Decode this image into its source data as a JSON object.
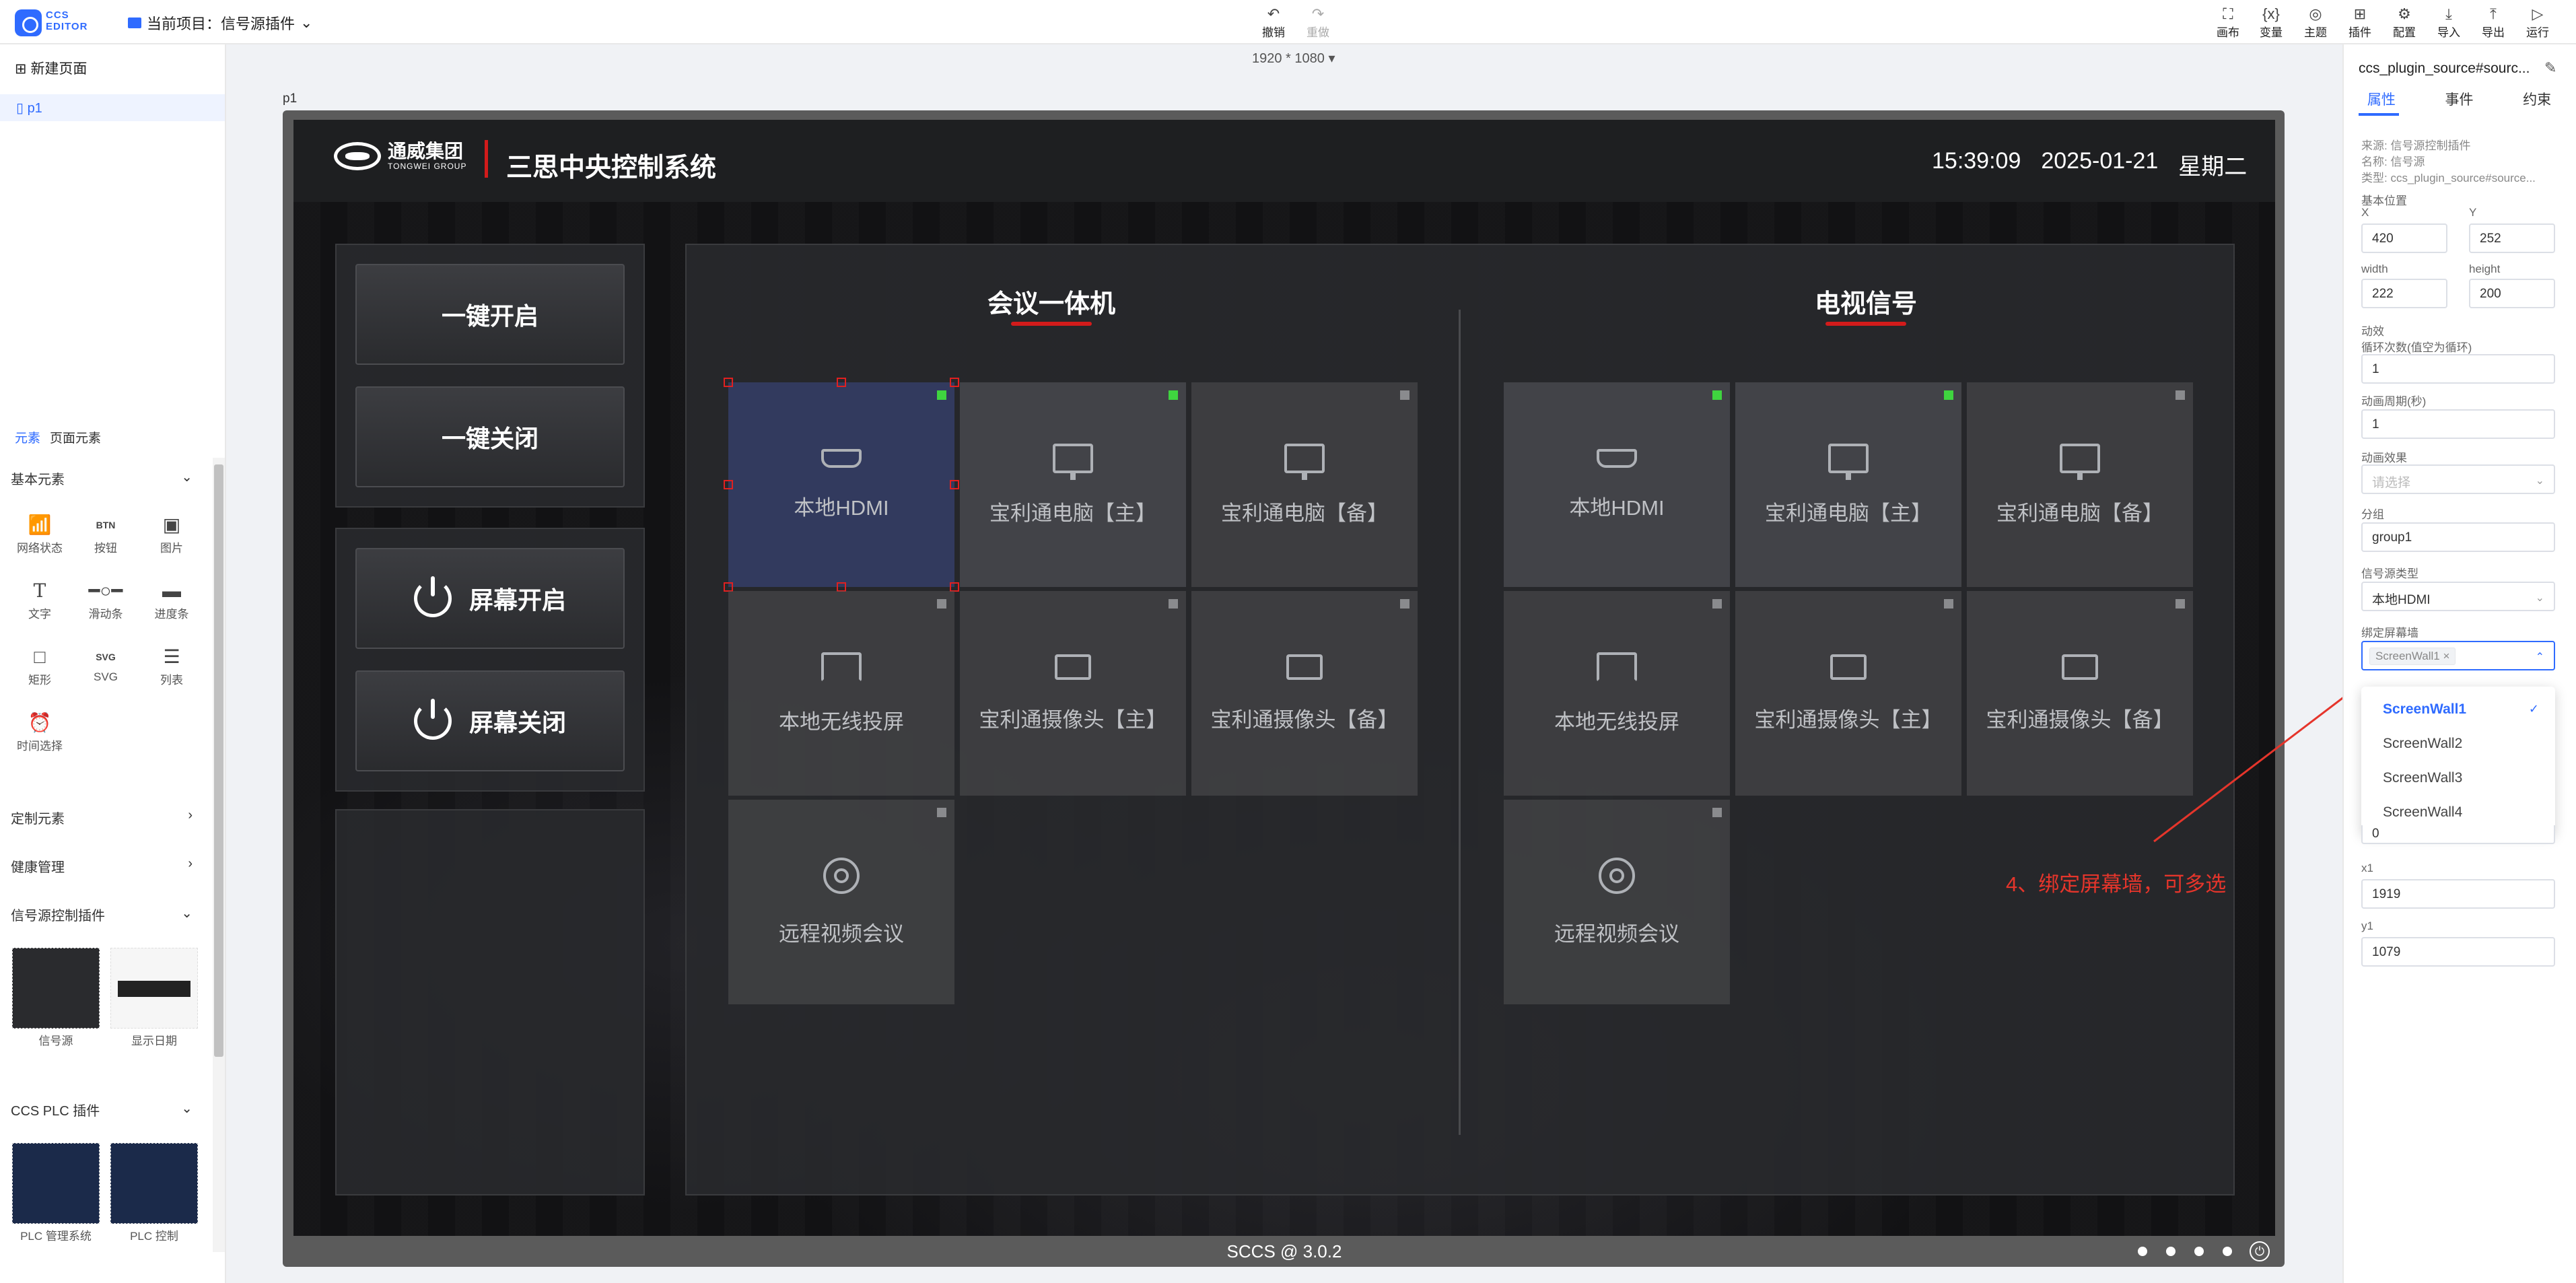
{
  "app": {
    "logo_text": "CCS\nEDITOR",
    "project_label": "当前项目：信号源插件"
  },
  "toolbar": {
    "undo": "撤销",
    "redo": "重做",
    "right": [
      "画布",
      "变量",
      "主题",
      "插件",
      "配置",
      "导入",
      "导出",
      "运行"
    ]
  },
  "left": {
    "new_page": "新建页面",
    "pages": [
      "p1"
    ],
    "tabs": [
      "元素",
      "页面元素"
    ],
    "basic_section": "基本元素",
    "basic_items": [
      {
        "label": "网络状态",
        "icon": "wifi-icon"
      },
      {
        "label": "按钮",
        "icon": "button-icon",
        "glyph": "BTN"
      },
      {
        "label": "图片",
        "icon": "image-icon"
      },
      {
        "label": "文字",
        "icon": "text-icon",
        "glyph": "T"
      },
      {
        "label": "滑动条",
        "icon": "slider-icon"
      },
      {
        "label": "进度条",
        "icon": "progress-icon"
      },
      {
        "label": "矩形",
        "icon": "rect-icon"
      },
      {
        "label": "SVG",
        "icon": "svg-icon",
        "glyph": "SVG"
      },
      {
        "label": "列表",
        "icon": "list-icon"
      },
      {
        "label": "时间选择",
        "icon": "clock-icon"
      }
    ],
    "sections": [
      "定制元素",
      "健康管理",
      "信号源控制插件"
    ],
    "signal_plugins": [
      "信号源",
      "显示日期"
    ],
    "plc_section": "CCS PLC 插件",
    "plc_plugins": [
      "PLC 管理系统",
      "PLC 控制"
    ]
  },
  "canvas": {
    "resolution": "1920 * 1080",
    "page_label": "p1",
    "corp_name": "通威集团",
    "corp_sub": "TONGWEI GROUP",
    "system_title": "三思中央控制系统",
    "time": "15:39:09",
    "date": "2025-01-21",
    "weekday": "星期二",
    "buttons": [
      "一键开启",
      "一键关闭",
      "屏幕开启",
      "屏幕关闭"
    ],
    "col1_title": "会议一体机",
    "col2_title": "电视信号",
    "sources": [
      "本地HDMI",
      "宝利通电脑【主】",
      "宝利通电脑【备】",
      "本地无线投屏",
      "宝利通摄像头【主】",
      "宝利通摄像头【备】",
      "远程视频会议"
    ],
    "footer": "SCCS @ 3.0.2"
  },
  "annotation": "4、绑定屏幕墙，可多选",
  "right": {
    "title": "ccs_plugin_source#sourc...",
    "tabs": [
      "属性",
      "事件",
      "约束"
    ],
    "meta": [
      "来源: 信号源控制插件",
      "名称: 信号源",
      "类型: ccs_plugin_source#source..."
    ],
    "basic_pos": "基本位置",
    "x_label": "X",
    "x": "420",
    "y_label": "Y",
    "y": "252",
    "w_label": "width",
    "w": "222",
    "h_label": "height",
    "h": "200",
    "anim": "动效",
    "loop_label": "循环次数(值空为循环)",
    "loop": "1",
    "period_label": "动画周期(秒)",
    "period": "1",
    "effect_label": "动画效果",
    "effect_ph": "请选择",
    "group_label": "分组",
    "group": "group1",
    "srctype_label": "信号源类型",
    "srctype": "本地HDMI",
    "wall_label": "绑定屏幕墙",
    "wall_tag": "ScreenWall1",
    "wall_options": [
      "ScreenWall1",
      "ScreenWall2",
      "ScreenWall3",
      "ScreenWall4"
    ],
    "hidden_value": "0",
    "x1_label": "x1",
    "x1": "1919",
    "y1_label": "y1",
    "y1": "1079"
  },
  "colors": {
    "accent": "#2f6bff",
    "brand_red": "#d21b1b",
    "led_on": "#3fd43f",
    "annotation": "#e5352b"
  }
}
